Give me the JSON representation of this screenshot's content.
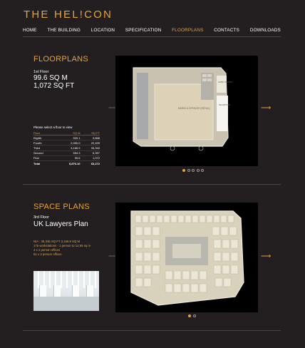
{
  "brand": {
    "logo_text": "THE HEL!CON",
    "accent": "#e7a33a",
    "background": "#231f20"
  },
  "nav": {
    "items": [
      {
        "label": "HOME"
      },
      {
        "label": "THE BUILDING"
      },
      {
        "label": "LOCATION"
      },
      {
        "label": "SPECIFICATION"
      },
      {
        "label": "FLOORPLANS",
        "active": true
      },
      {
        "label": "CONTACTS"
      },
      {
        "label": "DOWNLOADS"
      }
    ]
  },
  "floorplans": {
    "title": "FLOORPLANS",
    "floor": "1st Floor",
    "area_sqm": "99.6 SQ M",
    "area_sqft": "1,072 SQ FT",
    "hint": "Please select a floor to view",
    "columns": [
      "Floor",
      "SQ M",
      "SQ FT"
    ],
    "rows": [
      {
        "floor": "Eighth",
        "sqm": "920.1",
        "sqft": "9,868"
      },
      {
        "floor": "Fourth",
        "sqm": "2,090.0",
        "sqft": "22,499"
      },
      {
        "floor": "Third",
        "sqm": "3,166.9",
        "sqft": "33,340"
      },
      {
        "floor": "Second",
        "sqm": "594.3",
        "sqft": "6,397"
      },
      {
        "floor": "First",
        "sqm": "99.6",
        "sqft": "1,072"
      }
    ],
    "total": {
      "label": "Total",
      "sqm": "5,876.10",
      "sqft": "63,272"
    },
    "plan_labels": {
      "store": "MARKS & SPENCER (RETAIL)",
      "wc": "HWBC (RETAIL)",
      "reception": "RECEPTION"
    },
    "pager": {
      "count": 5,
      "active": 0
    }
  },
  "spaceplans": {
    "title": "SPACE PLANS",
    "floor": "3rd Floor",
    "plan_name": "UK Lawyers Plan",
    "info": [
      "NIA : 35,346 SQ FT 3,166.9 SQ M",
      "176 workstations - 1 person to 12.65 sq m",
      "4 x 1 person offices",
      "61 x 2 person offices"
    ],
    "pager": {
      "count": 2,
      "active": 0
    }
  },
  "icons": {
    "prev": "chevron-left-icon",
    "next": "chevron-right-icon"
  }
}
